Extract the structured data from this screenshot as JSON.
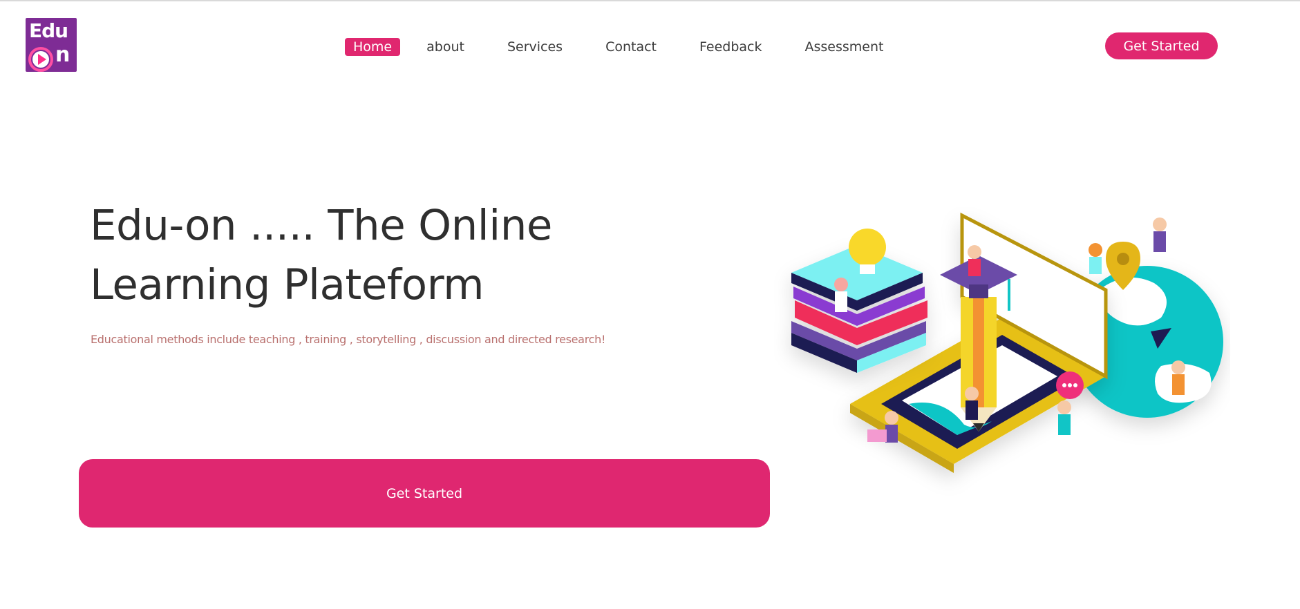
{
  "logo": {
    "line1": "Edu",
    "line2": "n",
    "icon": "play-icon"
  },
  "nav": {
    "items": [
      {
        "label": "Home",
        "active": true
      },
      {
        "label": "about"
      },
      {
        "label": "Services"
      },
      {
        "label": "Contact"
      },
      {
        "label": "Feedback"
      },
      {
        "label": "Assessment"
      }
    ]
  },
  "header": {
    "cta_label": "Get Started"
  },
  "hero": {
    "title": "Edu-on ..... The Online Learning Plateform",
    "subtitle": "Educational methods include teaching , training , storytelling , discussion and directed research!",
    "cta_label": "Get Started"
  },
  "colors": {
    "accent": "#e0276f",
    "brand_purple": "#7e2c95",
    "subtitle": "#b9706e"
  }
}
